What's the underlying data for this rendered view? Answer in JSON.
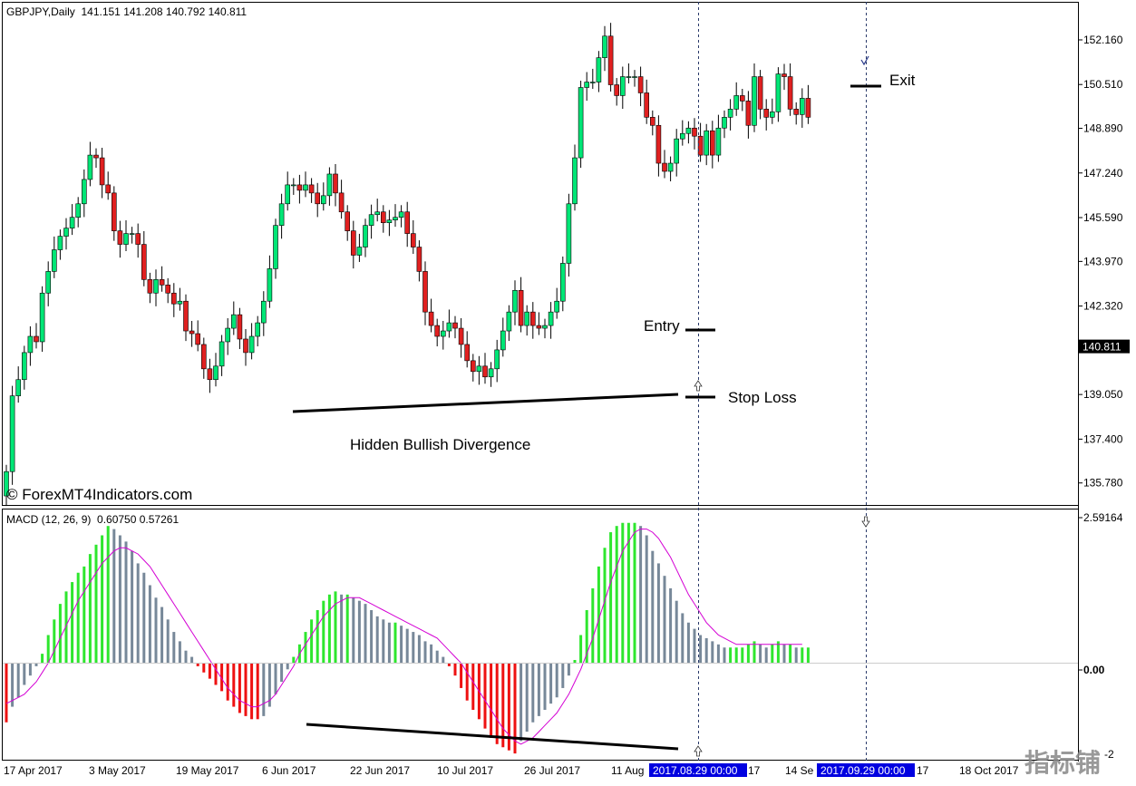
{
  "colors": {
    "bull": "#00e676",
    "bear": "#e02020",
    "wick": "#000000",
    "hist_up": "#2ee62e",
    "hist_down_pos": "#778899",
    "hist_down_neg": "#ee1111",
    "hist_up_neg": "#778899",
    "signal": "#d400d4",
    "price_tag_bg": "#000000",
    "date_tag_bg": "#0000e0"
  },
  "header": {
    "symbol_info": "GBPJPY,Daily  141.151 141.208 140.792 140.811",
    "watermark": "© ForexMT4Indicators.com",
    "logo_text": "指标铺"
  },
  "annotations": {
    "entry": "Entry",
    "exit": "Exit",
    "stop_loss": "Stop Loss",
    "divergence": "Hidden Bullish Divergence"
  },
  "macd": {
    "label": "MACD (12, 26, 9)  0.60750 0.57261",
    "axis_top": "2.59164",
    "axis_zero": "0.00",
    "axis_bottom": "-2"
  },
  "price_axis": {
    "current_price": "140.811",
    "labels": [
      "152.160",
      "150.510",
      "148.890",
      "147.240",
      "145.590",
      "143.970",
      "142.320",
      "139.050",
      "137.400",
      "135.780"
    ]
  },
  "time_axis": {
    "labels": [
      "17 Apr 2017",
      "3 May 2017",
      "19 May 2017",
      "6 Jun 2017",
      "22 Jun 2017",
      "10 Jul 2017",
      "26 Jul 2017",
      "11 Aug",
      "14 Se",
      "18 Oct 2017"
    ],
    "highlighted": [
      "2017.08.29 00:00",
      "2017.09.29 00:00"
    ],
    "trailing": [
      "17",
      "17",
      "17"
    ]
  },
  "chart_data": [
    {
      "type": "candlestick",
      "title": "GBPJPY,Daily",
      "ohlc_last": {
        "open": 141.151,
        "high": 141.208,
        "low": 140.792,
        "close": 140.811
      },
      "ylim": [
        135.0,
        153.5
      ],
      "x_range": [
        "2017-04-14",
        "2017-10-31"
      ],
      "close_series": [
        136.2,
        139.0,
        139.6,
        140.6,
        141.2,
        141.0,
        142.8,
        143.6,
        144.4,
        144.9,
        145.2,
        145.6,
        146.1,
        147.0,
        147.9,
        147.8,
        146.8,
        146.5,
        145.1,
        144.6,
        145.0,
        145.0,
        144.6,
        143.3,
        142.8,
        143.3,
        143.1,
        142.8,
        142.4,
        142.5,
        141.4,
        141.3,
        140.9,
        140.0,
        139.6,
        140.1,
        141.0,
        141.5,
        142.0,
        141.1,
        140.6,
        141.2,
        141.7,
        142.5,
        143.7,
        145.3,
        146.1,
        146.8,
        146.8,
        146.6,
        146.8,
        146.5,
        146.1,
        146.4,
        147.2,
        146.5,
        145.8,
        145.1,
        144.2,
        144.5,
        145.3,
        145.7,
        145.8,
        145.4,
        145.5,
        145.6,
        145.8,
        145.0,
        144.5,
        143.6,
        142.1,
        141.6,
        141.2,
        141.4,
        141.7,
        141.5,
        140.9,
        140.3,
        139.9,
        140.1,
        139.7,
        140.0,
        140.7,
        141.4,
        142.1,
        142.9,
        141.6,
        142.1,
        141.6,
        141.5,
        141.6,
        142.1,
        142.5,
        143.9,
        146.1,
        147.8,
        150.4,
        150.6,
        150.6,
        151.5,
        152.3,
        150.5,
        150.1,
        150.8,
        150.8,
        150.8,
        150.2,
        149.3,
        149.0,
        147.6,
        147.3,
        147.6,
        148.5,
        148.7,
        148.9,
        148.6,
        147.9,
        148.8,
        147.9,
        148.9,
        149.3,
        149.6,
        150.1,
        149.9,
        149.0,
        150.8,
        149.6,
        149.3,
        149.5,
        150.9,
        150.8,
        149.6,
        149.4,
        150.0,
        149.3
      ]
    },
    {
      "type": "bar",
      "title": "MACD (12, 26, 9)",
      "series": [
        {
          "name": "MACD",
          "values": [
            -1.9,
            -1.4,
            -1.1,
            -0.7,
            -0.4,
            -0.1,
            0.3,
            0.9,
            1.4,
            1.9,
            2.3,
            2.6,
            2.9,
            3.1,
            3.5,
            3.8,
            4.1,
            4.4,
            4.3,
            4.1,
            3.9,
            3.6,
            3.2,
            2.9,
            2.5,
            2.1,
            1.8,
            1.4,
            1.0,
            0.7,
            0.4,
            0.2,
            -0.1,
            -0.3,
            -0.5,
            -0.7,
            -0.9,
            -1.2,
            -1.4,
            -1.6,
            -1.7,
            -1.8,
            -1.8,
            -1.7,
            -1.4,
            -1.0,
            -0.6,
            -0.2,
            0.2,
            0.6,
            1.0,
            1.4,
            1.7,
            2.0,
            2.2,
            2.3,
            2.2,
            2.2,
            2.1,
            2.0,
            1.9,
            1.7,
            1.5,
            1.4,
            1.3,
            1.3,
            1.2,
            1.1,
            1.0,
            0.9,
            0.7,
            0.6,
            0.4,
            0.2,
            -0.1,
            -0.4,
            -0.8,
            -1.2,
            -1.5,
            -1.8,
            -2.1,
            -2.4,
            -2.6,
            -2.7,
            -2.8,
            -2.9,
            -2.5,
            -2.2,
            -1.9,
            -1.7,
            -1.5,
            -1.3,
            -1.1,
            -0.8,
            -0.4,
            0.1,
            0.9,
            1.7,
            2.4,
            3.1,
            3.7,
            4.2,
            4.4,
            4.5,
            4.5,
            4.5,
            4.4,
            4.1,
            3.6,
            3.2,
            2.8,
            2.4,
            2.0,
            1.6,
            1.3,
            1.1,
            0.9,
            0.8,
            0.7,
            0.6,
            0.5,
            0.5,
            0.5,
            0.5,
            0.6,
            0.7,
            0.6,
            0.5,
            0.6,
            0.7,
            0.6,
            0.6,
            0.5,
            0.5,
            0.5
          ]
        },
        {
          "name": "Signal",
          "values": [
            -1.3,
            -1.2,
            -1.1,
            -1.0,
            -0.8,
            -0.6,
            -0.3,
            0.0,
            0.4,
            0.8,
            1.2,
            1.6,
            2.0,
            2.3,
            2.6,
            2.9,
            3.2,
            3.4,
            3.6,
            3.7,
            3.7,
            3.6,
            3.5,
            3.3,
            3.1,
            2.8,
            2.5,
            2.2,
            1.9,
            1.6,
            1.3,
            1.0,
            0.7,
            0.4,
            0.1,
            -0.2,
            -0.5,
            -0.8,
            -1.0,
            -1.2,
            -1.3,
            -1.4,
            -1.4,
            -1.3,
            -1.2,
            -1.0,
            -0.7,
            -0.4,
            -0.1,
            0.3,
            0.6,
            0.9,
            1.2,
            1.5,
            1.7,
            1.9,
            2.0,
            2.1,
            2.1,
            2.1,
            2.0,
            1.9,
            1.8,
            1.7,
            1.6,
            1.5,
            1.4,
            1.3,
            1.2,
            1.1,
            1.0,
            0.9,
            0.8,
            0.6,
            0.4,
            0.2,
            0.0,
            -0.3,
            -0.6,
            -0.9,
            -1.2,
            -1.5,
            -1.8,
            -2.1,
            -2.3,
            -2.5,
            -2.6,
            -2.5,
            -2.4,
            -2.2,
            -2.0,
            -1.8,
            -1.6,
            -1.3,
            -1.0,
            -0.6,
            -0.2,
            0.3,
            0.8,
            1.4,
            2.0,
            2.6,
            3.1,
            3.6,
            3.9,
            4.2,
            4.3,
            4.3,
            4.2,
            4.0,
            3.7,
            3.4,
            3.0,
            2.6,
            2.2,
            1.9,
            1.6,
            1.3,
            1.1,
            0.9,
            0.8,
            0.7,
            0.6,
            0.6,
            0.6,
            0.6,
            0.6,
            0.6,
            0.6,
            0.6,
            0.6,
            0.6,
            0.6,
            0.6
          ]
        }
      ],
      "ylim": [
        -3.1,
        4.9
      ]
    }
  ]
}
